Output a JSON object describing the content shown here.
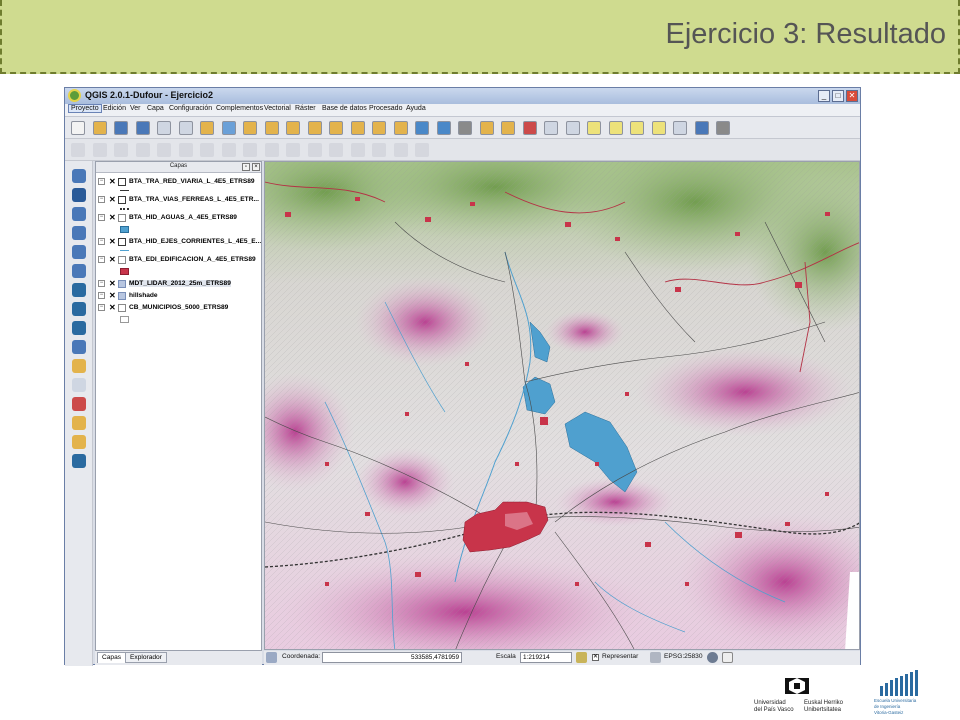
{
  "slide": {
    "title": "Ejercicio 3: Resultado"
  },
  "window": {
    "title": "QGIS 2.0.1-Dufour - Ejercicio2",
    "controls": [
      "_",
      "□",
      "✕"
    ]
  },
  "menu": [
    {
      "label": "Proyecto",
      "active": true
    },
    {
      "label": "Edición"
    },
    {
      "label": "Ver"
    },
    {
      "label": "Capa"
    },
    {
      "label": "Configuración"
    },
    {
      "label": "Complementos"
    },
    {
      "label": "Vectorial"
    },
    {
      "label": "Ráster"
    },
    {
      "label": "Base de datos"
    },
    {
      "label": "Procesado"
    },
    {
      "label": "Ayuda"
    }
  ],
  "layers_panel": {
    "title": "Capas",
    "layers": [
      {
        "name": "BTA_TRA_RED_VIARIA_L_4E5_ETRS89",
        "visible": true,
        "type": "line",
        "legend": "line-dark"
      },
      {
        "name": "BTA_TRA_VIAS_FERREAS_L_4E5_ETR...",
        "visible": true,
        "type": "line",
        "legend": "rail"
      },
      {
        "name": "BTA_HID_AGUAS_A_4E5_ETRS89",
        "visible": true,
        "type": "polygon",
        "legend": "water"
      },
      {
        "name": "BTA_HID_EJES_CORRIENTES_L_4E5_E...",
        "visible": true,
        "type": "line",
        "legend": "stream"
      },
      {
        "name": "BTA_EDI_EDIFICACION_A_4E5_ETRS89",
        "visible": true,
        "type": "polygon",
        "legend": "building"
      },
      {
        "name": "MDT_LIDAR_2012_25m_ETRS89",
        "visible": true,
        "type": "raster",
        "legend": "none",
        "selected": true
      },
      {
        "name": "hillshade",
        "visible": true,
        "type": "raster",
        "legend": "none"
      },
      {
        "name": "CB_MUNICIPIOS_5000_ETRS89",
        "visible": true,
        "type": "polygon",
        "legend": "municipio"
      }
    ],
    "tabs": [
      {
        "label": "Capas",
        "active": true
      },
      {
        "label": "Explorador"
      }
    ]
  },
  "status_bar": {
    "coordinate_label": "Coordenada:",
    "coordinate_value": "533585,4781959",
    "scale_label": "Escala",
    "scale_value": "1:219214",
    "render_label": "Representar",
    "render_checked": true,
    "crs": "EPSG:25830"
  },
  "logos": {
    "upv_line1": "Universidad",
    "upv_line2": "del País Vasco",
    "ehu_line1": "Euskal Herriko",
    "ehu_line2": "Unibertsitatea",
    "eui_line1": "Escuela Universitaria",
    "eui_line2": "de Ingeniería",
    "eui_line3": "Vitoria-Gasteiz"
  },
  "colors": {
    "header_bg": "#cfdb8f",
    "header_border": "#6f7d2e",
    "water": "#4fa0cf",
    "building": "#c8344a",
    "road": "#4a4a4a",
    "relief_low": "#7fa85a",
    "relief_high": "#b73a8e"
  },
  "icons": {
    "toolbar1": [
      "new-project-icon",
      "open-project-icon",
      "save-project-icon",
      "save-as-icon",
      "print-composer-icon",
      "composer-manager-icon",
      "pan-icon",
      "pan-to-selection-icon",
      "zoom-in-icon",
      "zoom-out-icon",
      "zoom-native-icon",
      "zoom-full-icon",
      "zoom-selection-icon",
      "zoom-layer-icon",
      "zoom-last-icon",
      "zoom-next-icon",
      "refresh-icon",
      "identify-icon",
      "measure-icon",
      "select-icon",
      "deselect-icon",
      "field-calc-icon",
      "attribute-table-icon",
      "statistics-icon",
      "map-tips-icon",
      "new-bookmark-icon",
      "show-bookmarks-icon",
      "annotation-icon",
      "text-annotation-icon",
      "help-icon",
      "whats-this-icon"
    ],
    "left": [
      "add-vector-icon",
      "add-raster-icon",
      "add-postgis-icon",
      "add-spatialite-icon",
      "add-mssql-icon",
      "add-oracle-icon",
      "add-wms-icon",
      "add-wcs-icon",
      "add-wfs-icon",
      "add-delimited-icon",
      "new-shapefile-icon",
      "new-spatialite-icon",
      "gps-icon",
      "georeferencer-icon",
      "add-feature-icon",
      "edit-node-icon"
    ]
  }
}
